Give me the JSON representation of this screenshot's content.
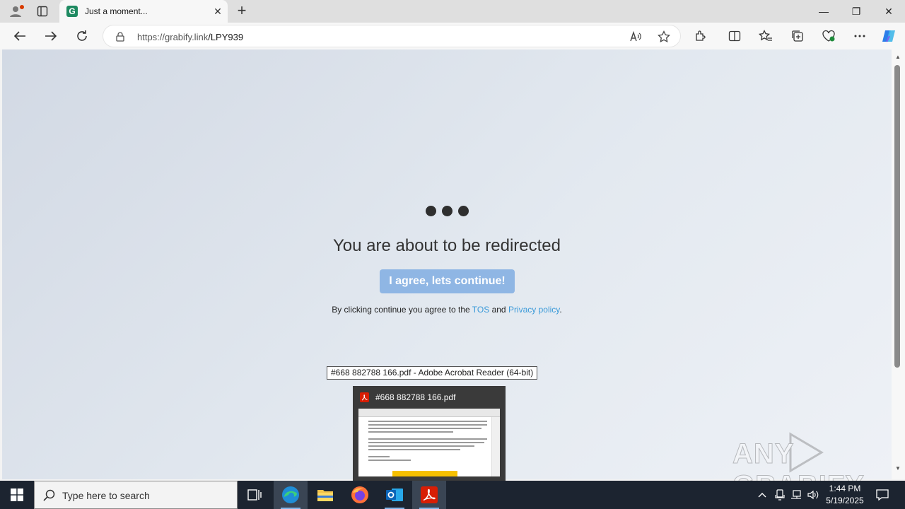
{
  "browser": {
    "tab": {
      "favicon_letter": "G",
      "title": "Just a moment...",
      "close_glyph": "✕"
    },
    "new_tab_glyph": "+",
    "url_host": "https://grabify.link",
    "url_path": "/LPY939",
    "window_controls": {
      "minimize": "—",
      "maximize": "❐",
      "close": "✕"
    }
  },
  "page": {
    "headline": "You are about to be redirected",
    "agree_button": "I agree, lets continue!",
    "terms_prefix": "By clicking continue you agree to the ",
    "tos_link": "TOS",
    "terms_and": " and ",
    "privacy_link": "Privacy policy",
    "terms_suffix": "."
  },
  "overlay": {
    "tooltip": "#668 882788 166.pdf - Adobe Acrobat Reader (64-bit)",
    "preview_title": "#668 882788 166.pdf"
  },
  "watermark": {
    "text": "ANY GRABIFY"
  },
  "taskbar": {
    "search_placeholder": "Type here to search",
    "time": "1:44 PM",
    "date": "5/19/2025"
  },
  "colors": {
    "accent_button": "#8fb6e4",
    "link": "#3a9ad9",
    "favicon": "#1e8a61",
    "taskbar": "#1c2430"
  }
}
